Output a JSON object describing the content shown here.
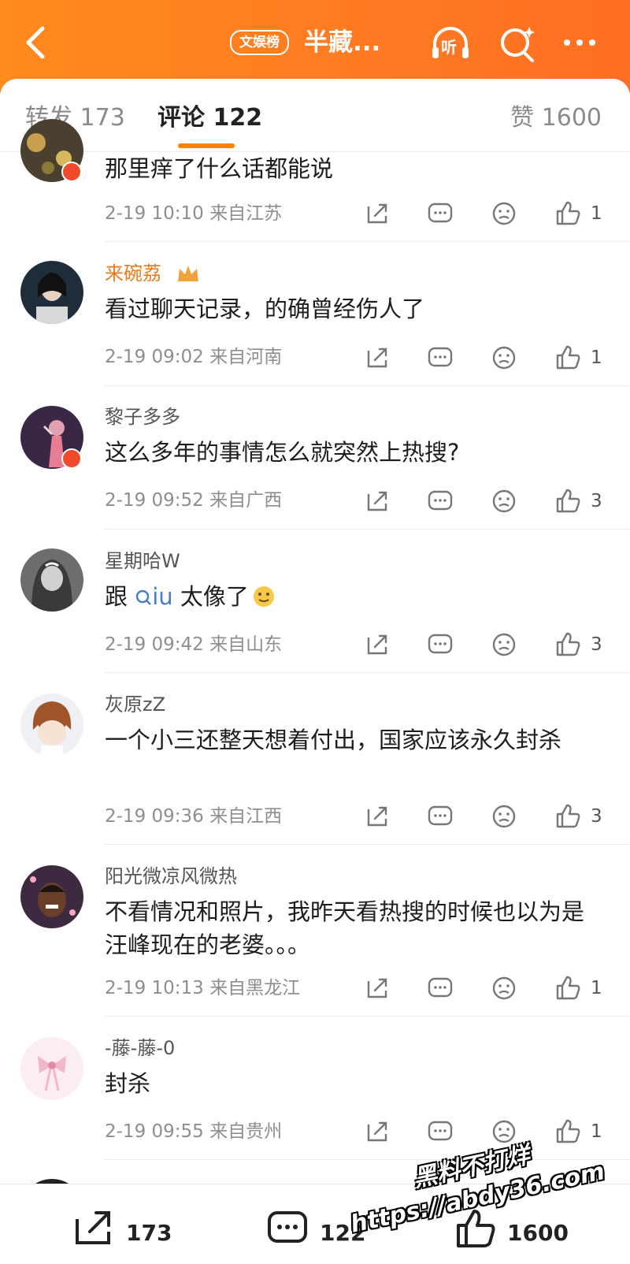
{
  "header": {
    "badge": "文娱榜",
    "title": "半藏...",
    "listen_label": "听"
  },
  "tabs": {
    "repost": "转发 173",
    "comments": "评论 122",
    "likes": "赞 1600"
  },
  "comments": [
    {
      "user": "",
      "text": "那里痒了什么话都能说",
      "meta": "2-19 10:10 来自江苏",
      "likes": "1"
    },
    {
      "user": "来碗荔",
      "text": "看过聊天记录，的确曾经伤人了",
      "meta": "2-19 09:02 来自河南",
      "likes": "1"
    },
    {
      "user": "黎子多多",
      "text": "这么多年的事情怎么就突然上热搜?",
      "meta": "2-19 09:52 来自广西",
      "likes": "3"
    },
    {
      "user": "星期哈W",
      "text_prefix": "跟 ",
      "text_link": "iu",
      "text_suffix": " 太像了",
      "meta": "2-19 09:42 来自山东",
      "likes": "3"
    },
    {
      "user": "灰原zZ",
      "text": "一个小三还整天想着付出，国家应该永久封杀",
      "meta": "2-19 09:36 来自江西",
      "likes": "3"
    },
    {
      "user": "阳光微凉风微热",
      "text": "不看情况和照片，我昨天看热搜的时候也以为是汪峰现在的老婆。。。",
      "meta": "2-19 10:13 来自黑龙江",
      "likes": "1"
    },
    {
      "user": "-藤-藤-0",
      "text": "封杀",
      "meta": "2-19 09:55 来自贵州",
      "likes": "1"
    }
  ],
  "bottom_bar": {
    "repost_count": "173",
    "comment_count": "122",
    "like_count": "1600"
  },
  "watermark": {
    "line1": "黑料不打烊",
    "line2": "https://abdy36.com"
  },
  "colors": {
    "header_orange": "#ff7a22",
    "accent": "#ff8200",
    "vip_name": "#ea7a1a"
  }
}
